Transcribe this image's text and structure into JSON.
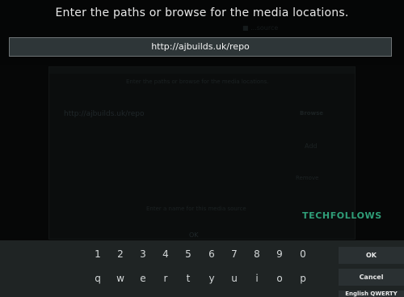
{
  "prompt": "Enter the paths or browse for the media locations.",
  "input": {
    "value": "http://ajbuilds.uk/repo"
  },
  "background_dialog": {
    "ghost_top": "■ ...source",
    "instruction": "Enter the paths or browse for the media locations.",
    "path_entry": "http://ajbuilds.uk/repo",
    "browse_label": "Browse",
    "add_label": "Add",
    "remove_label": "Remove",
    "name_field": "Enter a name for this media source",
    "ok_label": "OK"
  },
  "watermark": "TECHFOLLOWS",
  "keyboard": {
    "digits": [
      "1",
      "2",
      "3",
      "4",
      "5",
      "6",
      "7",
      "8",
      "9",
      "0"
    ],
    "letters": [
      "q",
      "w",
      "e",
      "r",
      "t",
      "y",
      "u",
      "i",
      "o",
      "p"
    ],
    "ok_label": "OK",
    "cancel_label": "Cancel",
    "layout_label": "English QWERTY"
  }
}
